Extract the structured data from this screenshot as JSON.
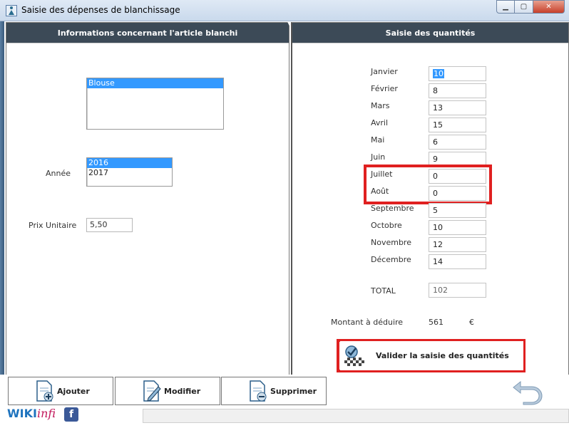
{
  "window": {
    "title": "Saisie des dépenses de blanchissage",
    "controls": {
      "minimize": "▁",
      "maximize": "▢",
      "close": "✕"
    }
  },
  "left_panel": {
    "header": "Informations concernant l'article blanchi",
    "article_list": [
      "Blouse"
    ],
    "article_selected": "Blouse",
    "year_label": "Année",
    "years": [
      "2016",
      "2017"
    ],
    "year_selected": "2016",
    "unit_price_label": "Prix Unitaire",
    "unit_price_value": "5,50"
  },
  "right_panel": {
    "header": "Saisie des quantités",
    "months": [
      {
        "label": "Janvier",
        "value": "10"
      },
      {
        "label": "Février",
        "value": "8"
      },
      {
        "label": "Mars",
        "value": "13"
      },
      {
        "label": "Avril",
        "value": "15"
      },
      {
        "label": "Mai",
        "value": "6"
      },
      {
        "label": "Juin",
        "value": "9"
      },
      {
        "label": "Juillet",
        "value": "0"
      },
      {
        "label": "Août",
        "value": "0"
      },
      {
        "label": "Septembre",
        "value": "5"
      },
      {
        "label": "Octobre",
        "value": "10"
      },
      {
        "label": "Novembre",
        "value": "12"
      },
      {
        "label": "Décembre",
        "value": "14"
      }
    ],
    "total_label": "TOTAL",
    "total_value": "102",
    "amount_label": "Montant à déduire",
    "amount_value": "561",
    "currency": "€",
    "validate_label": "Valider la saisie des quantités"
  },
  "toolbar": {
    "add_label": "Ajouter",
    "modify_label": "Modifier",
    "delete_label": "Supprimer"
  },
  "branding": {
    "wiki": "WIKI",
    "infi": "infi",
    "facebook": "f"
  },
  "colors": {
    "header_bg": "#3c4a57",
    "selection": "#3399ff",
    "highlight": "#e02020"
  }
}
